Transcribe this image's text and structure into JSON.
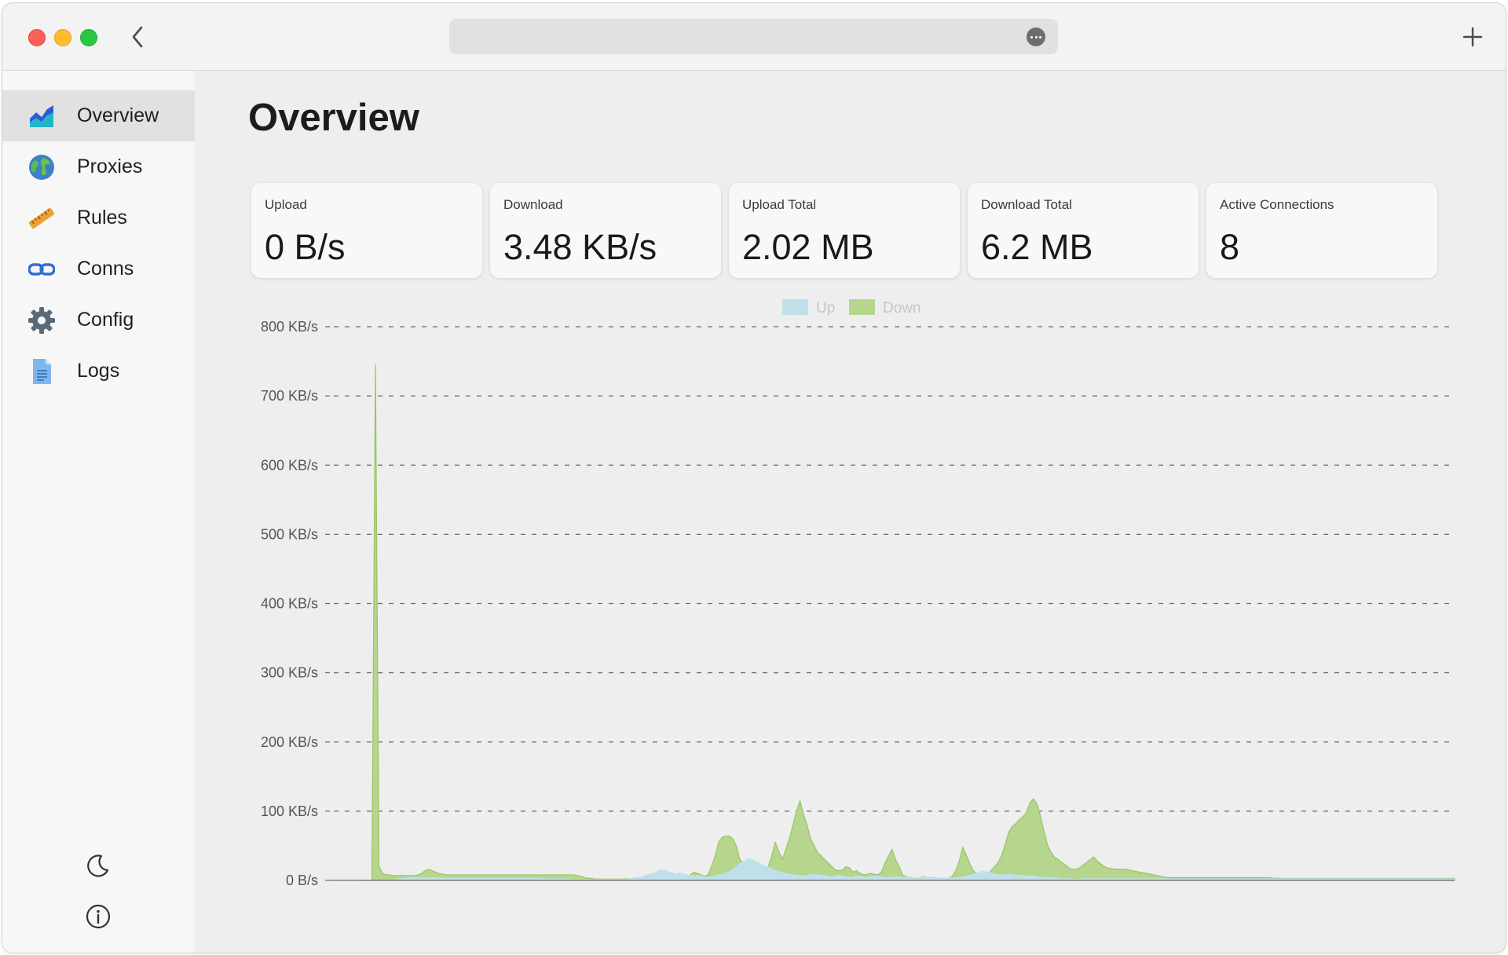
{
  "window": {
    "traffic_lights": [
      "close",
      "minimize",
      "zoom"
    ],
    "colors": {
      "close": "#fe5f57",
      "minimize": "#febc2e",
      "zoom": "#28c840"
    }
  },
  "toolbar": {
    "back_icon": "chevron-left-icon",
    "more_icon": "ellipsis-circle-icon",
    "new_tab_icon": "plus-icon"
  },
  "sidebar": {
    "items": [
      {
        "label": "Overview",
        "icon": "chart-area-icon",
        "active": true
      },
      {
        "label": "Proxies",
        "icon": "globe-icon",
        "active": false
      },
      {
        "label": "Rules",
        "icon": "ruler-icon",
        "active": false
      },
      {
        "label": "Conns",
        "icon": "link-icon",
        "active": false
      },
      {
        "label": "Config",
        "icon": "gear-icon",
        "active": false
      },
      {
        "label": "Logs",
        "icon": "document-icon",
        "active": false
      }
    ],
    "bottom": [
      "moon-icon",
      "info-icon"
    ]
  },
  "main": {
    "title": "Overview",
    "stats": [
      {
        "label": "Upload",
        "value": "0 B/s"
      },
      {
        "label": "Download",
        "value": "3.48 KB/s"
      },
      {
        "label": "Upload Total",
        "value": "2.02 MB"
      },
      {
        "label": "Download Total",
        "value": "6.2 MB"
      },
      {
        "label": "Active Connections",
        "value": "8"
      }
    ]
  },
  "chart_data": {
    "type": "area",
    "title": "",
    "xlabel": "",
    "ylabel": "",
    "ylim": [
      0,
      800
    ],
    "yticks": [
      0,
      100,
      200,
      300,
      400,
      500,
      600,
      700,
      800
    ],
    "ytick_labels": [
      "0 B/s",
      "100 KB/s",
      "200 KB/s",
      "300 KB/s",
      "400 KB/s",
      "500 KB/s",
      "600 KB/s",
      "700 KB/s",
      "800 KB/s"
    ],
    "grid": true,
    "legend_position": "top-center",
    "colors": {
      "Up": "#bfe0ea",
      "Down": "#b5d68c",
      "Down_line": "#98c463"
    },
    "series": [
      {
        "name": "Up",
        "values": [
          0,
          0,
          0,
          0,
          0,
          0,
          0,
          0,
          3,
          4,
          5,
          5,
          4,
          4,
          4,
          5,
          4,
          4,
          4,
          4,
          4,
          4,
          4,
          4,
          4,
          4,
          4,
          4,
          4,
          4,
          4,
          4,
          4,
          4,
          4,
          4,
          4,
          3,
          3,
          3,
          3,
          3,
          3,
          2,
          2,
          2,
          2,
          2,
          2,
          2,
          2,
          2,
          2,
          2,
          2,
          3,
          5,
          5,
          8,
          10,
          12,
          16,
          15,
          12,
          10,
          12,
          9,
          8,
          7,
          8,
          6,
          5,
          7,
          9,
          10,
          13,
          18,
          24,
          28,
          32,
          30,
          26,
          22,
          20,
          16,
          14,
          12,
          10,
          9,
          8,
          7,
          8,
          10,
          9,
          8,
          7,
          6,
          8,
          7,
          6,
          5,
          7,
          6,
          5,
          6,
          7,
          6,
          5,
          5,
          6,
          5,
          5,
          4,
          4,
          4,
          5,
          4,
          5,
          4,
          4,
          4,
          4,
          5,
          6,
          8,
          10,
          12,
          14,
          12,
          10,
          9,
          8,
          10,
          9,
          8,
          8,
          7,
          7,
          6,
          5,
          5,
          5,
          4,
          3,
          3,
          3,
          2,
          3,
          3,
          3,
          3,
          3,
          3,
          3,
          3,
          3,
          3,
          3,
          3,
          3,
          3,
          3,
          3,
          3,
          3,
          3,
          3,
          3,
          3,
          3,
          3,
          3,
          3,
          3,
          3,
          3,
          3,
          3,
          3,
          3,
          3,
          3,
          3,
          3,
          3,
          3,
          3,
          3,
          3,
          3,
          3,
          3,
          3,
          3,
          3,
          3,
          3,
          3,
          3,
          3,
          3,
          3,
          3,
          3,
          3,
          3,
          3,
          3,
          3,
          3,
          3,
          3,
          3,
          3,
          3,
          3,
          3,
          3,
          3,
          3,
          3,
          3,
          3,
          3
        ]
      },
      {
        "name": "Down",
        "values": [
          0,
          0,
          0,
          0,
          745,
          20,
          10,
          8,
          8,
          7,
          7,
          7,
          7,
          7,
          7,
          7,
          8,
          10,
          14,
          16,
          14,
          12,
          10,
          9,
          8,
          8,
          8,
          8,
          8,
          8,
          8,
          8,
          8,
          8,
          8,
          8,
          8,
          8,
          8,
          8,
          8,
          8,
          8,
          8,
          8,
          8,
          8,
          8,
          8,
          8,
          8,
          8,
          8,
          8,
          8,
          8,
          8,
          8,
          8,
          8,
          8,
          7,
          6,
          4,
          3,
          3,
          2,
          2,
          2,
          2,
          2,
          2,
          2,
          2,
          2,
          2,
          2,
          2,
          2,
          2,
          2,
          2,
          2,
          2,
          2,
          2,
          2,
          2,
          2,
          2,
          2,
          2,
          4,
          8,
          12,
          10,
          8,
          6,
          8,
          20,
          35,
          55,
          62,
          64,
          64,
          60,
          50,
          30,
          24,
          22,
          20,
          18,
          16,
          14,
          12,
          20,
          35,
          55,
          42,
          30,
          45,
          60,
          80,
          100,
          115,
          95,
          80,
          60,
          50,
          40,
          35,
          30,
          25,
          20,
          15,
          14,
          15,
          20,
          18,
          12,
          14,
          10,
          8,
          9,
          10,
          9,
          8,
          12,
          25,
          35,
          45,
          30,
          20,
          8,
          5,
          4,
          3,
          3,
          4,
          5,
          4,
          4,
          3,
          3,
          3,
          3,
          3,
          6,
          14,
          28,
          48,
          36,
          24,
          14,
          9,
          6,
          5,
          8,
          14,
          20,
          26,
          36,
          52,
          70,
          78,
          82,
          88,
          92,
          98,
          112,
          118,
          110,
          92,
          70,
          50,
          40,
          33,
          30,
          26,
          22,
          18,
          16,
          16,
          18,
          22,
          26,
          30,
          34,
          28,
          24,
          20,
          18,
          17,
          16,
          16,
          16,
          16,
          15,
          14,
          13,
          12,
          11,
          10,
          9,
          8,
          7,
          6,
          5,
          4,
          4,
          4,
          4,
          4,
          4,
          4,
          4,
          4,
          4,
          4,
          4,
          4,
          4,
          4,
          4,
          4,
          4,
          4,
          4,
          4,
          4,
          4,
          4,
          4,
          4,
          4,
          4,
          4,
          4,
          3,
          3,
          3,
          3,
          3,
          3,
          3,
          3,
          3,
          3,
          3,
          3,
          3,
          3,
          3,
          3,
          3,
          3,
          3,
          3,
          3,
          3,
          3,
          3,
          3,
          3,
          3,
          3,
          3,
          3,
          3,
          3,
          3,
          3,
          3,
          3,
          3,
          3,
          3,
          3,
          3,
          3,
          3,
          3,
          3,
          3,
          3,
          3,
          3,
          3,
          3,
          3
        ]
      }
    ]
  }
}
